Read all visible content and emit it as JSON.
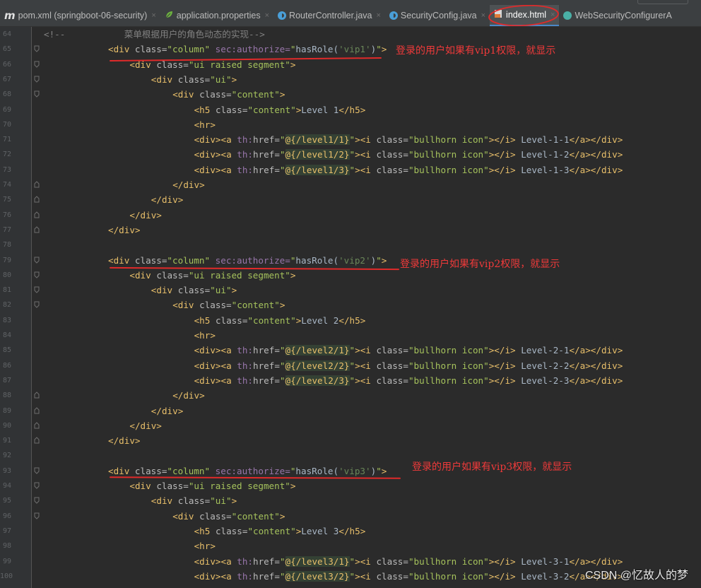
{
  "tabs": [
    {
      "label": "pom.xml (springboot-06-security)",
      "icon": "maven-icon",
      "active": false
    },
    {
      "label": "application.properties",
      "icon": "spring-leaf-icon",
      "active": false
    },
    {
      "label": "RouterController.java",
      "icon": "java-class-icon",
      "active": false
    },
    {
      "label": "SecurityConfig.java",
      "icon": "java-class-icon",
      "active": false
    },
    {
      "label": "index.html",
      "icon": "html-file-icon",
      "active": true
    },
    {
      "label": "WebSecurityConfigurerA",
      "icon": "interface-icon",
      "active": false
    }
  ],
  "code_lines": [
    {
      "n": "64",
      "segs": [
        [
          "cm",
          "<!--           菜单根据用户的角色动态的实现-->"
        ]
      ]
    },
    {
      "n": "65",
      "segs": [
        [
          "t",
          "<div "
        ],
        [
          "a",
          "class="
        ],
        [
          "s",
          "\"column\" "
        ],
        [
          "ns",
          "sec:authorize="
        ],
        [
          "s",
          "\""
        ],
        [
          "el",
          "hasRole("
        ],
        [
          "arg",
          "'vip1'"
        ],
        [
          "el",
          ")"
        ],
        [
          "s",
          "\""
        ],
        [
          "t",
          ">"
        ]
      ],
      "indent": 1
    },
    {
      "n": "66",
      "segs": [
        [
          "t",
          "<div "
        ],
        [
          "a",
          "class="
        ],
        [
          "s",
          "\"ui raised segment\""
        ],
        [
          "t",
          ">"
        ]
      ],
      "indent": 2
    },
    {
      "n": "67",
      "segs": [
        [
          "t",
          "<div "
        ],
        [
          "a",
          "class="
        ],
        [
          "s",
          "\"ui\""
        ],
        [
          "t",
          ">"
        ]
      ],
      "indent": 3
    },
    {
      "n": "68",
      "segs": [
        [
          "t",
          "<div "
        ],
        [
          "a",
          "class="
        ],
        [
          "s",
          "\"content\""
        ],
        [
          "t",
          ">"
        ]
      ],
      "indent": 4
    },
    {
      "n": "69",
      "segs": [
        [
          "t",
          "<h5 "
        ],
        [
          "a",
          "class="
        ],
        [
          "s",
          "\"content\""
        ],
        [
          "t",
          ">"
        ],
        [
          "x",
          "Level 1"
        ],
        [
          "t",
          "</h5>"
        ]
      ],
      "indent": 5
    },
    {
      "n": "70",
      "segs": [
        [
          "t",
          "<hr>"
        ]
      ],
      "indent": 5
    },
    {
      "n": "71",
      "segs": [
        [
          "t",
          "<div><a "
        ],
        [
          "ns",
          "th:"
        ],
        [
          "a",
          "href="
        ],
        [
          "s",
          "\""
        ],
        [
          "hl",
          "@{/level1/1}"
        ],
        [
          "s",
          "\""
        ],
        [
          "t",
          "><i "
        ],
        [
          "a",
          "class="
        ],
        [
          "s",
          "\"bullhorn icon\""
        ],
        [
          "t",
          "></i>"
        ],
        [
          "x",
          " Level-1-1"
        ],
        [
          "t",
          "</a></div>"
        ]
      ],
      "indent": 5
    },
    {
      "n": "72",
      "segs": [
        [
          "t",
          "<div><a "
        ],
        [
          "ns",
          "th:"
        ],
        [
          "a",
          "href="
        ],
        [
          "s",
          "\""
        ],
        [
          "hl",
          "@{/level1/2}"
        ],
        [
          "s",
          "\""
        ],
        [
          "t",
          "><i "
        ],
        [
          "a",
          "class="
        ],
        [
          "s",
          "\"bullhorn icon\""
        ],
        [
          "t",
          "></i>"
        ],
        [
          "x",
          " Level-1-2"
        ],
        [
          "t",
          "</a></div>"
        ]
      ],
      "indent": 5
    },
    {
      "n": "73",
      "segs": [
        [
          "t",
          "<div><a "
        ],
        [
          "ns",
          "th:"
        ],
        [
          "a",
          "href="
        ],
        [
          "s",
          "\""
        ],
        [
          "hl",
          "@{/level1/3}"
        ],
        [
          "s",
          "\""
        ],
        [
          "t",
          "><i "
        ],
        [
          "a",
          "class="
        ],
        [
          "s",
          "\"bullhorn icon\""
        ],
        [
          "t",
          "></i>"
        ],
        [
          "x",
          " Level-1-3"
        ],
        [
          "t",
          "</a></div>"
        ]
      ],
      "indent": 5
    },
    {
      "n": "74",
      "segs": [
        [
          "t",
          "</div>"
        ]
      ],
      "indent": 4
    },
    {
      "n": "75",
      "segs": [
        [
          "t",
          "</div>"
        ]
      ],
      "indent": 3
    },
    {
      "n": "76",
      "segs": [
        [
          "t",
          "</div>"
        ]
      ],
      "indent": 2
    },
    {
      "n": "77",
      "segs": [
        [
          "t",
          "</div>"
        ]
      ],
      "indent": 1
    },
    {
      "n": "78",
      "segs": []
    },
    {
      "n": "79",
      "segs": [
        [
          "t",
          "<div "
        ],
        [
          "a",
          "class="
        ],
        [
          "s",
          "\"column\" "
        ],
        [
          "ns",
          "sec:authorize="
        ],
        [
          "s",
          "\""
        ],
        [
          "el",
          "hasRole("
        ],
        [
          "arg",
          "'vip2'"
        ],
        [
          "el",
          ")"
        ],
        [
          "s",
          "\""
        ],
        [
          "t",
          ">"
        ]
      ],
      "indent": 1
    },
    {
      "n": "80",
      "segs": [
        [
          "t",
          "<div "
        ],
        [
          "a",
          "class="
        ],
        [
          "s",
          "\"ui raised segment\""
        ],
        [
          "t",
          ">"
        ]
      ],
      "indent": 2
    },
    {
      "n": "81",
      "segs": [
        [
          "t",
          "<div "
        ],
        [
          "a",
          "class="
        ],
        [
          "s",
          "\"ui\""
        ],
        [
          "t",
          ">"
        ]
      ],
      "indent": 3
    },
    {
      "n": "82",
      "segs": [
        [
          "t",
          "<div "
        ],
        [
          "a",
          "class="
        ],
        [
          "s",
          "\"content\""
        ],
        [
          "t",
          ">"
        ]
      ],
      "indent": 4
    },
    {
      "n": "83",
      "segs": [
        [
          "t",
          "<h5 "
        ],
        [
          "a",
          "class="
        ],
        [
          "s",
          "\"content\""
        ],
        [
          "t",
          ">"
        ],
        [
          "x",
          "Level 2"
        ],
        [
          "t",
          "</h5>"
        ]
      ],
      "indent": 5
    },
    {
      "n": "84",
      "segs": [
        [
          "t",
          "<hr>"
        ]
      ],
      "indent": 5
    },
    {
      "n": "85",
      "segs": [
        [
          "t",
          "<div><a "
        ],
        [
          "ns",
          "th:"
        ],
        [
          "a",
          "href="
        ],
        [
          "s",
          "\""
        ],
        [
          "hl",
          "@{/level2/1}"
        ],
        [
          "s",
          "\""
        ],
        [
          "t",
          "><i "
        ],
        [
          "a",
          "class="
        ],
        [
          "s",
          "\"bullhorn icon\""
        ],
        [
          "t",
          "></i>"
        ],
        [
          "x",
          " Level-2-1"
        ],
        [
          "t",
          "</a></div>"
        ]
      ],
      "indent": 5
    },
    {
      "n": "86",
      "segs": [
        [
          "t",
          "<div><a "
        ],
        [
          "ns",
          "th:"
        ],
        [
          "a",
          "href="
        ],
        [
          "s",
          "\""
        ],
        [
          "hl",
          "@{/level2/2}"
        ],
        [
          "s",
          "\""
        ],
        [
          "t",
          "><i "
        ],
        [
          "a",
          "class="
        ],
        [
          "s",
          "\"bullhorn icon\""
        ],
        [
          "t",
          "></i>"
        ],
        [
          "x",
          " Level-2-2"
        ],
        [
          "t",
          "</a></div>"
        ]
      ],
      "indent": 5
    },
    {
      "n": "87",
      "segs": [
        [
          "t",
          "<div><a "
        ],
        [
          "ns",
          "th:"
        ],
        [
          "a",
          "href="
        ],
        [
          "s",
          "\""
        ],
        [
          "hl",
          "@{/level2/3}"
        ],
        [
          "s",
          "\""
        ],
        [
          "t",
          "><i "
        ],
        [
          "a",
          "class="
        ],
        [
          "s",
          "\"bullhorn icon\""
        ],
        [
          "t",
          "></i>"
        ],
        [
          "x",
          " Level-2-3"
        ],
        [
          "t",
          "</a></div>"
        ]
      ],
      "indent": 5
    },
    {
      "n": "88",
      "segs": [
        [
          "t",
          "</div>"
        ]
      ],
      "indent": 4
    },
    {
      "n": "89",
      "segs": [
        [
          "t",
          "</div>"
        ]
      ],
      "indent": 3
    },
    {
      "n": "90",
      "segs": [
        [
          "t",
          "</div>"
        ]
      ],
      "indent": 2
    },
    {
      "n": "91",
      "segs": [
        [
          "t",
          "</div>"
        ]
      ],
      "indent": 1
    },
    {
      "n": "92",
      "segs": []
    },
    {
      "n": "93",
      "segs": [
        [
          "t",
          "<div "
        ],
        [
          "a",
          "class="
        ],
        [
          "s",
          "\"column\" "
        ],
        [
          "ns",
          "sec:authorize="
        ],
        [
          "s",
          "\""
        ],
        [
          "el",
          "hasRole("
        ],
        [
          "arg",
          "'vip3'"
        ],
        [
          "el",
          ")"
        ],
        [
          "s",
          "\""
        ],
        [
          "t",
          ">"
        ]
      ],
      "indent": 1
    },
    {
      "n": "94",
      "segs": [
        [
          "t",
          "<div "
        ],
        [
          "a",
          "class="
        ],
        [
          "s",
          "\"ui raised segment\""
        ],
        [
          "t",
          ">"
        ]
      ],
      "indent": 2
    },
    {
      "n": "95",
      "segs": [
        [
          "t",
          "<div "
        ],
        [
          "a",
          "class="
        ],
        [
          "s",
          "\"ui\""
        ],
        [
          "t",
          ">"
        ]
      ],
      "indent": 3
    },
    {
      "n": "96",
      "segs": [
        [
          "t",
          "<div "
        ],
        [
          "a",
          "class="
        ],
        [
          "s",
          "\"content\""
        ],
        [
          "t",
          ">"
        ]
      ],
      "indent": 4
    },
    {
      "n": "97",
      "segs": [
        [
          "t",
          "<h5 "
        ],
        [
          "a",
          "class="
        ],
        [
          "s",
          "\"content\""
        ],
        [
          "t",
          ">"
        ],
        [
          "x",
          "Level 3"
        ],
        [
          "t",
          "</h5>"
        ]
      ],
      "indent": 5
    },
    {
      "n": "98",
      "segs": [
        [
          "t",
          "<hr>"
        ]
      ],
      "indent": 5
    },
    {
      "n": "99",
      "segs": [
        [
          "t",
          "<div><a "
        ],
        [
          "ns",
          "th:"
        ],
        [
          "a",
          "href="
        ],
        [
          "s",
          "\""
        ],
        [
          "hl",
          "@{/level3/1}"
        ],
        [
          "s",
          "\""
        ],
        [
          "t",
          "><i "
        ],
        [
          "a",
          "class="
        ],
        [
          "s",
          "\"bullhorn icon\""
        ],
        [
          "t",
          "></i>"
        ],
        [
          "x",
          " Level-3-1"
        ],
        [
          "t",
          "</a></div>"
        ]
      ],
      "indent": 5
    },
    {
      "n": "100",
      "segs": [
        [
          "t",
          "<div><a "
        ],
        [
          "ns",
          "th:"
        ],
        [
          "a",
          "href="
        ],
        [
          "s",
          "\""
        ],
        [
          "hl",
          "@{/level3/2}"
        ],
        [
          "s",
          "\""
        ],
        [
          "t",
          "><i "
        ],
        [
          "a",
          "class="
        ],
        [
          "s",
          "\"bullhorn icon\""
        ],
        [
          "t",
          "></i>"
        ],
        [
          "x",
          " Level-3-2"
        ],
        [
          "t",
          "</a></div>"
        ]
      ],
      "indent": 5
    }
  ],
  "annotations": [
    {
      "text": "登录的用户如果有vip1权限，就显示"
    },
    {
      "text": "登录的用户如果有vip2权限，就显示"
    },
    {
      "text": "登录的用户如果有vip3权限，就显示"
    }
  ],
  "watermark": "CSDN @忆故人的梦",
  "colors": {
    "annotation": "#f03a3a",
    "tag": "#e8bf6a",
    "attr_value": "#a5c25c",
    "namespace": "#9876aa"
  }
}
